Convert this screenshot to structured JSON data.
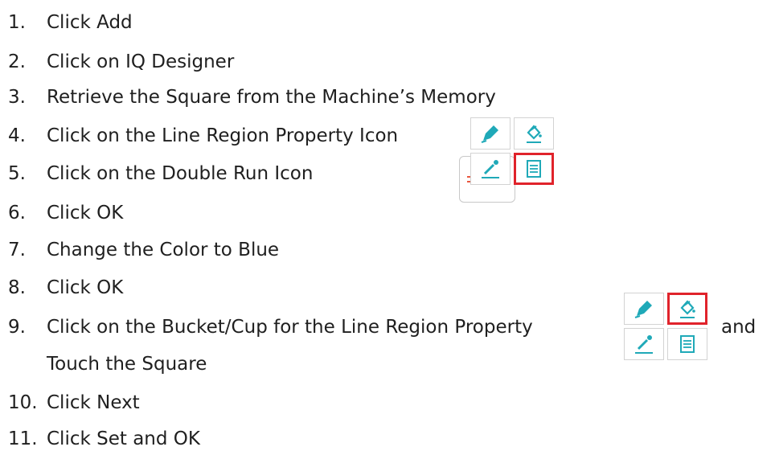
{
  "steps": [
    {
      "number": "1.",
      "text": "Click Add"
    },
    {
      "number": "2.",
      "text": "Click on IQ Designer"
    },
    {
      "number": "3.",
      "text": "Retrieve the Square from the Machine’s Memory"
    },
    {
      "number": "4.",
      "text": "Click on the Line Region Property Icon"
    },
    {
      "number": "5.",
      "text": "Click on the Double Run Icon"
    },
    {
      "number": "6.",
      "text": "Click OK"
    },
    {
      "number": "7.",
      "text": "Change the Color to Blue"
    },
    {
      "number": "8.",
      "text": "Click OK"
    },
    {
      "number": "9.",
      "text": "Click on the Bucket/Cup for the Line Region Property",
      "suffix": "and",
      "continuation": "Touch the Square"
    },
    {
      "number": "10.",
      "text": "Click Next"
    },
    {
      "number": "11.",
      "text": "Click Set and OK"
    }
  ],
  "icons": {
    "icon_color": "#1fa9b8",
    "highlight_color": "#e0232b",
    "double_run_color": "#e9573f"
  }
}
